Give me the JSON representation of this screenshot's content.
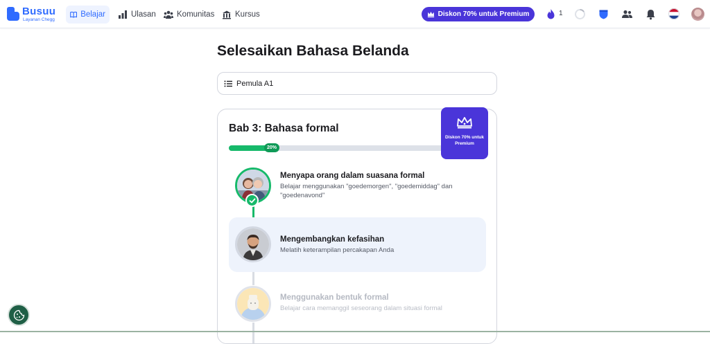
{
  "brand": {
    "name": "Busuu",
    "subtitle": "Layanan Chegg",
    "color": "#2f6bff"
  },
  "nav": {
    "items": [
      {
        "label": "Belajar",
        "icon": "book-icon",
        "active": true
      },
      {
        "label": "Ulasan",
        "icon": "bar-chart-icon",
        "active": false
      },
      {
        "label": "Komunitas",
        "icon": "community-icon",
        "active": false
      },
      {
        "label": "Kursus",
        "icon": "courses-icon",
        "active": false
      }
    ]
  },
  "header": {
    "promo_label": "Diskon 70% untuk Premium",
    "streak_count": "1",
    "flag": "Netherlands"
  },
  "main": {
    "title": "Selesaikan Bahasa Belanda",
    "level": "Pemula A1",
    "chapter": {
      "title": "Bab 3: Bahasa formal",
      "progress_label": "20%",
      "progress": 0.2,
      "premium_badge": "Diskon 70% untuk Premium",
      "lessons": [
        {
          "title": "Menyapa orang dalam suasana formal",
          "description": "Belajar menggunakan \"goedemorgen\", \"goedemiddag\" dan \"goedenavond\"",
          "status": "completed"
        },
        {
          "title": "Mengembangkan kefasihan",
          "description": "Melatih keterampilan percakapan Anda",
          "status": "current"
        },
        {
          "title": "Menggunakan bentuk formal",
          "description": "Belajar cara memanggil seseorang dalam situasi formal",
          "status": "locked"
        }
      ]
    }
  },
  "colors": {
    "accent": "#4a35d9",
    "success": "#16b96a"
  }
}
